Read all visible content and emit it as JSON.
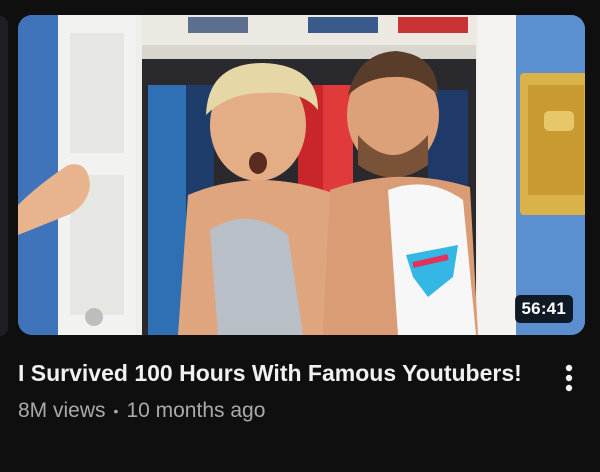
{
  "video": {
    "duration": "56:41",
    "title": "I Survived 100 Hours With Famous Youtubers!",
    "views": "8M views",
    "separator": "•",
    "age": "10 months ago"
  },
  "icons": {
    "more": "more-vertical-icon"
  },
  "colors": {
    "background": "#0f0f0f",
    "title": "#f1f1f1",
    "meta": "#aaaaaa",
    "duration_badge": "#000000"
  }
}
